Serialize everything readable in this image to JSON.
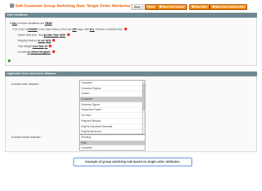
{
  "header": {
    "title": "Edit Customer Group Switching Rule 'Single Order Attributes'",
    "buttons": {
      "back": "Back",
      "reset": "Reset",
      "save_and_execute": "Save And Execute",
      "save_rule": "Save Rule",
      "save_and_continue": "Save And Continue Edit"
    }
  },
  "rule_conditions": {
    "heading": "Rule Conditions",
    "line1": {
      "a": "If",
      "b": "ALL",
      "c": "of these conditions are",
      "d": "TRUE",
      "e": ":"
    },
    "line2": {
      "a": "If an order is",
      "b": "FOUND",
      "c": "in the order history",
      "d": "of the last",
      "e": "120",
      "f": "days, with",
      "g": "ALL",
      "h": "of these conditions true:"
    },
    "line3": {
      "a": "Grand Total (Incl. Tax)",
      "b": "greater than",
      "c": "1000"
    },
    "line4": {
      "a": "Shipping Method",
      "b": "is not",
      "c": "UPS"
    },
    "line5": {
      "a": "Total Weight",
      "b": "less than",
      "c": "20"
    },
    "line6": {
      "a": "Country",
      "b": "is",
      "c": "United Kingdom"
    }
  },
  "statuses": {
    "heading": "Applicable Order and Invoice Statuses",
    "order_label": "Included order statuses",
    "invoice_label": "Included invoice statuses",
    "required_mark": "*",
    "order_options": [
      {
        "label": "Canceled",
        "selected": false
      },
      {
        "label": "Canceled Ogone",
        "selected": false
      },
      {
        "label": "Closed",
        "selected": false
      },
      {
        "label": "Complete",
        "selected": true
      },
      {
        "label": "Declined Ogone",
        "selected": false
      },
      {
        "label": "Suspected Fraud",
        "selected": false
      },
      {
        "label": "On Hold",
        "selected": false
      },
      {
        "label": "Payment Review",
        "selected": false
      },
      {
        "label": "PayPal Canceled Reversal",
        "selected": false
      },
      {
        "label": "PayPal Reversed",
        "selected": false
      }
    ],
    "invoice_options": [
      {
        "label": "Pending",
        "selected": false
      },
      {
        "label": "Paid",
        "selected": true
      },
      {
        "label": "Canceled",
        "selected": false
      }
    ]
  },
  "caption": "Example of group switching rule based on single order attributes.",
  "colors": {
    "accent": "#eb5e00",
    "button": "#f18200",
    "section_header": "#6f8992",
    "remove": "#e33b2f",
    "add": "#3a9b3a"
  }
}
